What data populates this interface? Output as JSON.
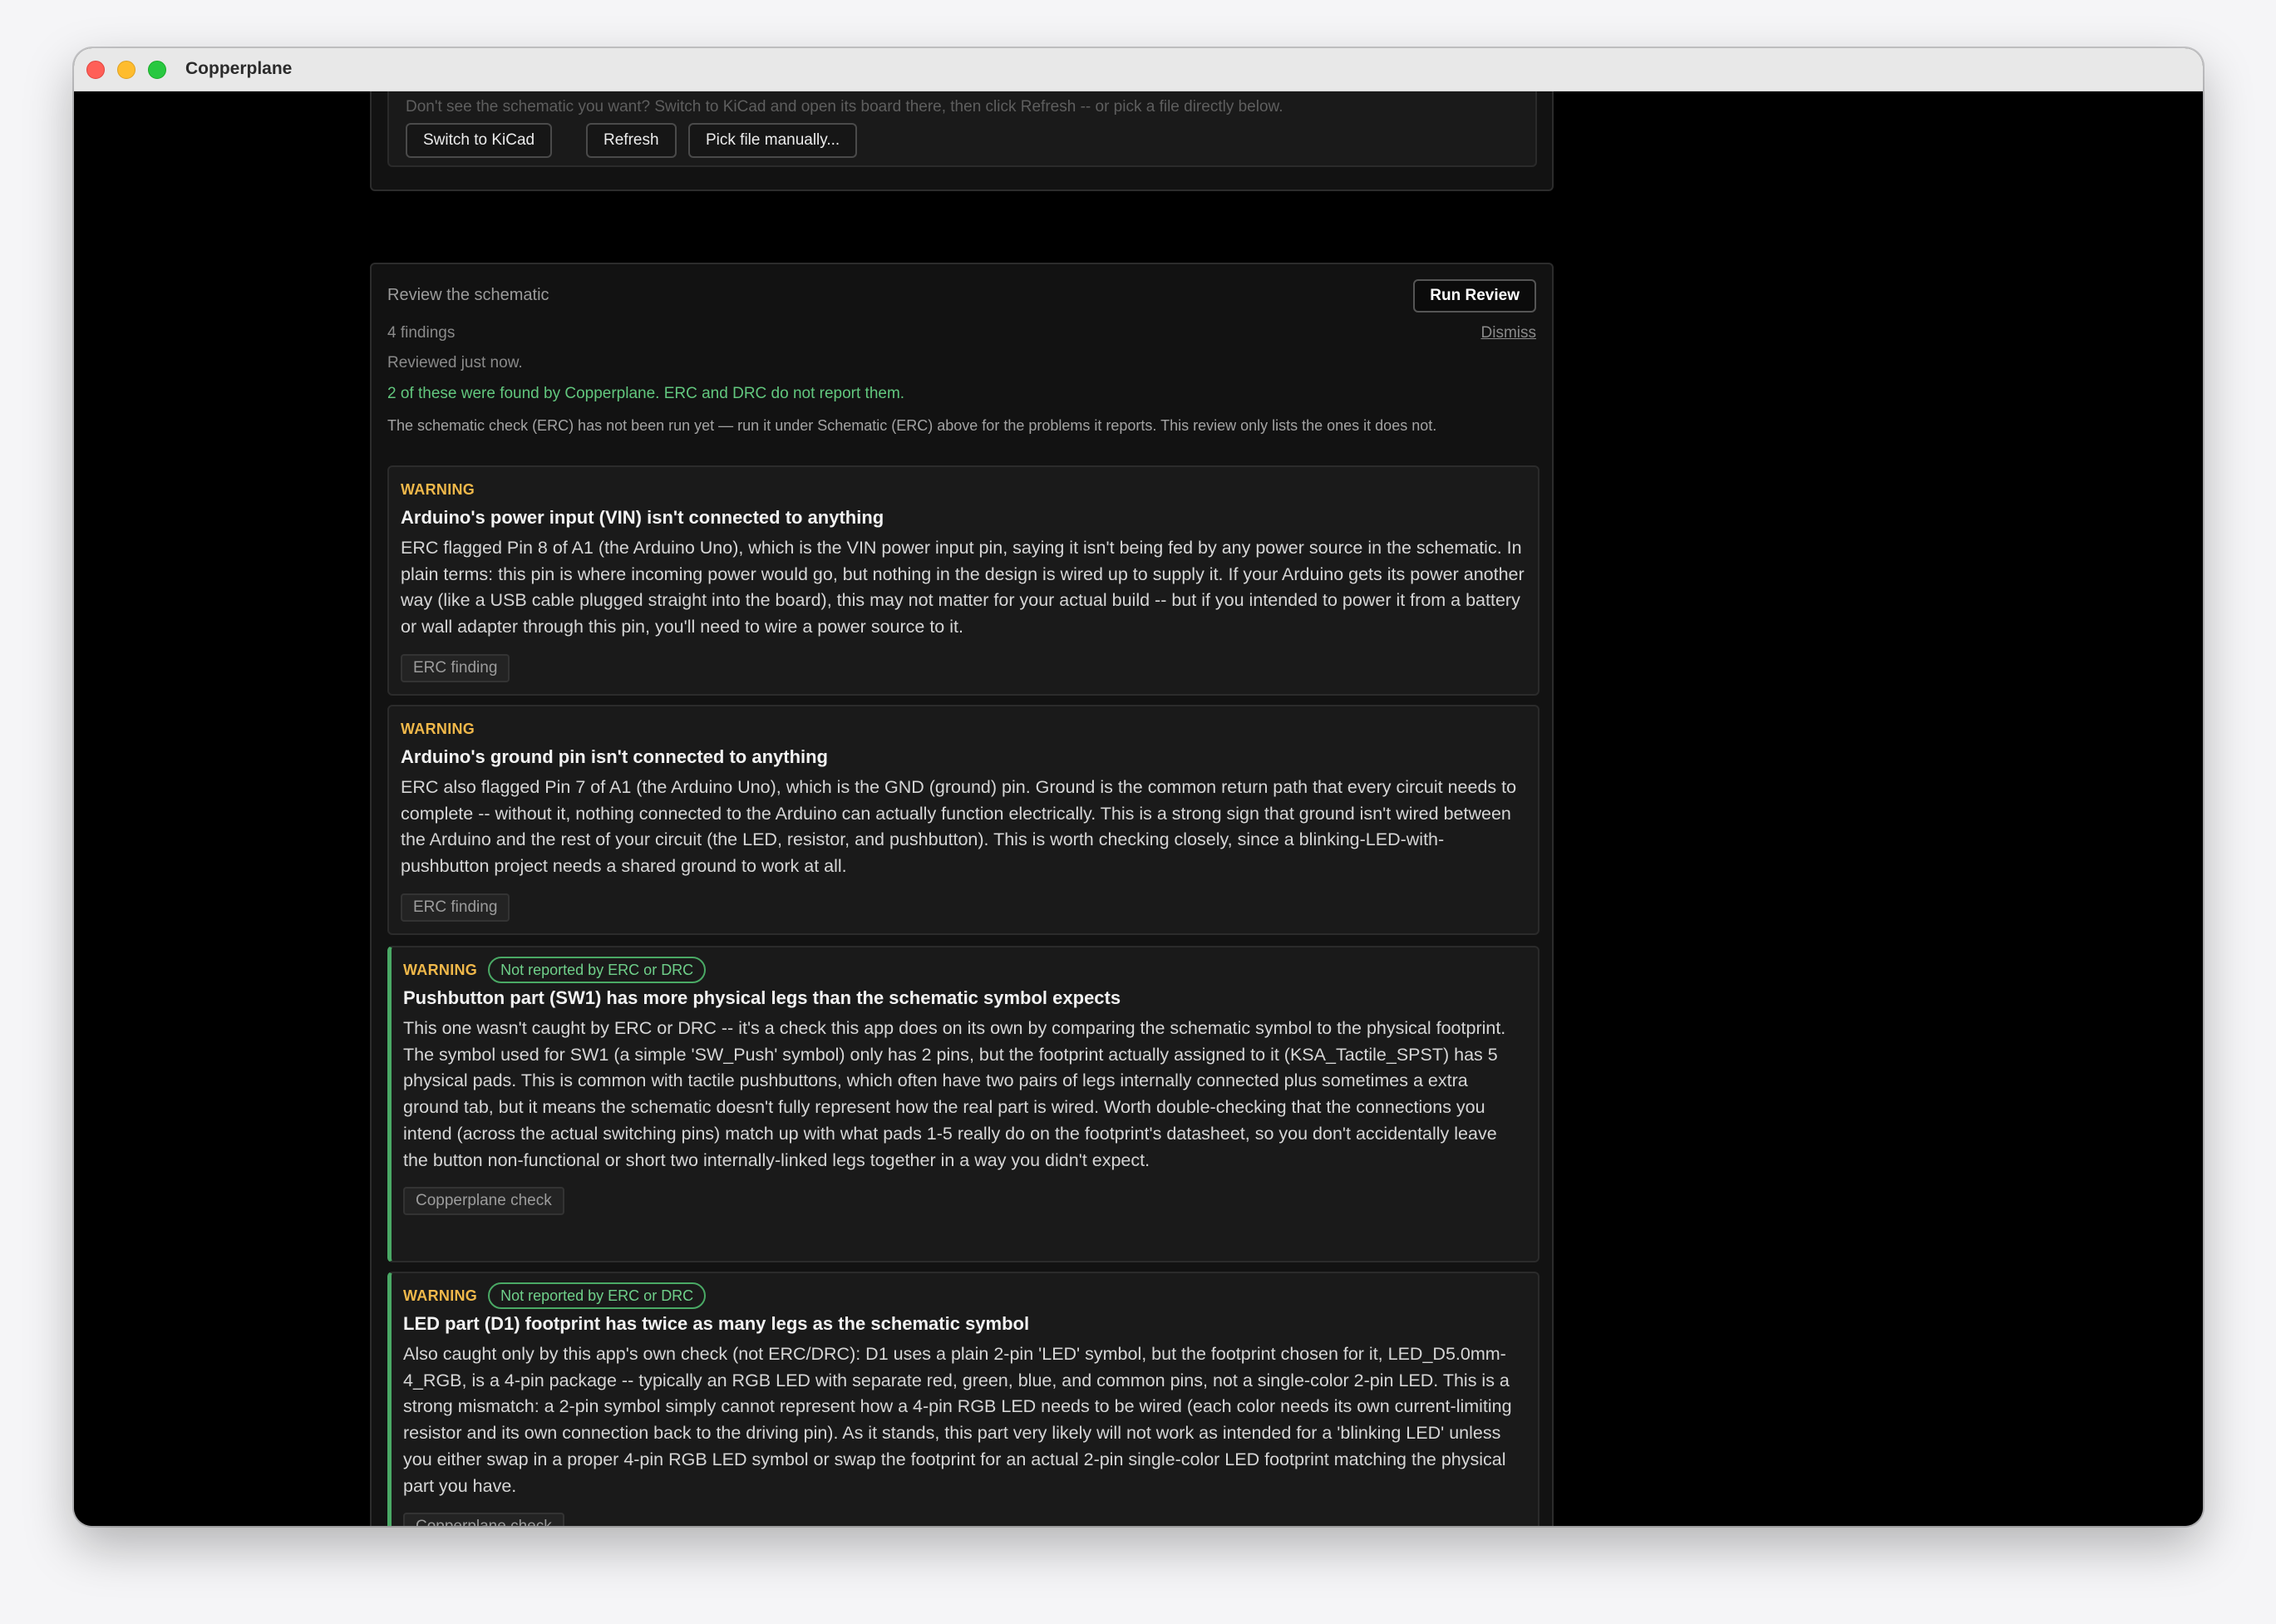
{
  "window": {
    "title": "Copperplane"
  },
  "source": {
    "hint": "Don't see the schematic you want? Switch to KiCad and open its board there, then click Refresh -- or pick a file directly below.",
    "buttons": {
      "switch": "Switch to KiCad",
      "refresh": "Refresh",
      "pick": "Pick file manually..."
    }
  },
  "review": {
    "title": "Review the schematic",
    "run_label": "Run Review",
    "count": "4 findings",
    "dismiss": "Dismiss",
    "reviewed": "Reviewed just now.",
    "copperplane_note": "2 of these were found by Copperplane. ERC and DRC do not report them.",
    "erc_note": "The schematic check (ERC) has not been run yet — run it under Schematic (ERC) above for the problems it reports. This review only lists the ones it does not.",
    "findings": [
      {
        "severity": "WARNING",
        "title": "Arduino's power input (VIN) isn't connected to anything",
        "body": "ERC flagged Pin 8 of A1 (the Arduino Uno), which is the VIN power input pin, saying it isn't being fed by any power source in the schematic. In plain terms: this pin is where incoming power would go, but nothing in the design is wired up to supply it. If your Arduino gets its power another way (like a USB cable plugged straight into the board), this may not matter for your actual build -- but if you intended to power it from a battery or wall adapter through this pin, you'll need to wire a power source to it.",
        "tag": "ERC finding"
      },
      {
        "severity": "WARNING",
        "title": "Arduino's ground pin isn't connected to anything",
        "body": "ERC also flagged Pin 7 of A1 (the Arduino Uno), which is the GND (ground) pin. Ground is the common return path that every circuit needs to complete -- without it, nothing connected to the Arduino can actually function electrically. This is a strong sign that ground isn't wired between the Arduino and the rest of your circuit (the LED, resistor, and pushbutton). This is worth checking closely, since a blinking-LED-with-pushbutton project needs a shared ground to work at all.",
        "tag": "ERC finding"
      },
      {
        "severity": "WARNING",
        "badge": "Not reported by ERC or DRC",
        "title": "Pushbutton part (SW1) has more physical legs than the schematic symbol expects",
        "body": "This one wasn't caught by ERC or DRC -- it's a check this app does on its own by comparing the schematic symbol to the physical footprint. The symbol used for SW1 (a simple 'SW_Push' symbol) only has 2 pins, but the footprint actually assigned to it (KSA_Tactile_SPST) has 5 physical pads. This is common with tactile pushbuttons, which often have two pairs of legs internally connected plus sometimes a extra ground tab, but it means the schematic doesn't fully represent how the real part is wired. Worth double-checking that the connections you intend (across the actual switching pins) match up with what pads 1-5 really do on the footprint's datasheet, so you don't accidentally leave the button non-functional or short two internally-linked legs together in a way you didn't expect.",
        "tag": "Copperplane check"
      },
      {
        "severity": "WARNING",
        "badge": "Not reported by ERC or DRC",
        "title": "LED part (D1) footprint has twice as many legs as the schematic symbol",
        "body": "Also caught only by this app's own check (not ERC/DRC): D1 uses a plain 2-pin 'LED' symbol, but the footprint chosen for it, LED_D5.0mm-4_RGB, is a 4-pin package -- typically an RGB LED with separate red, green, blue, and common pins, not a single-color 2-pin LED. This is a strong mismatch: a 2-pin symbol simply cannot represent how a 4-pin RGB LED needs to be wired (each color needs its own current-limiting resistor and its own connection back to the driving pin). As it stands, this part very likely will not work as intended for a 'blinking LED' unless you either swap in a proper 4-pin RGB LED symbol or swap the footprint for an actual 2-pin single-color LED footprint matching the physical part you have.",
        "tag": "Copperplane check"
      }
    ]
  }
}
